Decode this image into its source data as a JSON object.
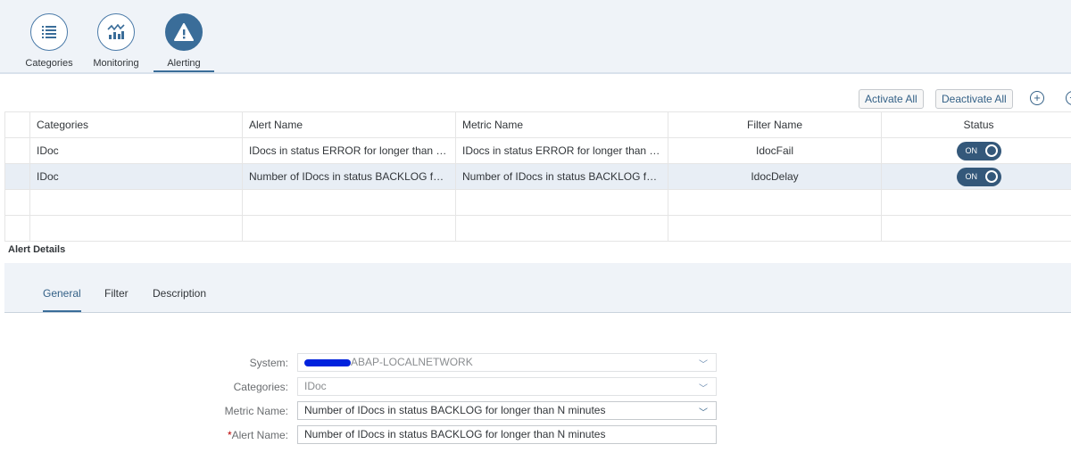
{
  "nav": [
    {
      "label": "Categories",
      "icon": "list-icon"
    },
    {
      "label": "Monitoring",
      "icon": "chart-icon"
    },
    {
      "label": "Alerting",
      "icon": "alert-icon",
      "active": true
    }
  ],
  "toolbar": {
    "activate_all": "Activate All",
    "deactivate_all": "Deactivate All"
  },
  "table": {
    "headers": [
      "Categories",
      "Alert Name",
      "Metric Name",
      "Filter Name",
      "Status"
    ],
    "rows": [
      {
        "category": "IDoc",
        "alert": "IDocs in status ERROR for longer than N...",
        "metric": "IDocs in status ERROR for longer than N...",
        "filter": "IdocFail",
        "status": "ON"
      },
      {
        "category": "IDoc",
        "alert": "Number of IDocs in status BACKLOG for...",
        "metric": "Number of IDocs in status BACKLOG for...",
        "filter": "IdocDelay",
        "status": "ON"
      }
    ]
  },
  "details": {
    "title": "Alert Details",
    "tabs": [
      "General",
      "Filter",
      "Description"
    ]
  },
  "form": {
    "system_label": "System:",
    "system_value": "ABAP-LOCALNETWORK",
    "categories_label": "Categories:",
    "categories_value": "IDoc",
    "metric_label": "Metric Name:",
    "metric_value": "Number of IDocs in status BACKLOG for longer than N minutes",
    "alert_required": "*",
    "alert_label": "Alert Name:",
    "alert_value": "Number of IDocs in status BACKLOG for longer than N minutes"
  },
  "colors": {
    "accent": "#3a6d99",
    "toggle": "#34587a",
    "required": "#bb0000"
  }
}
